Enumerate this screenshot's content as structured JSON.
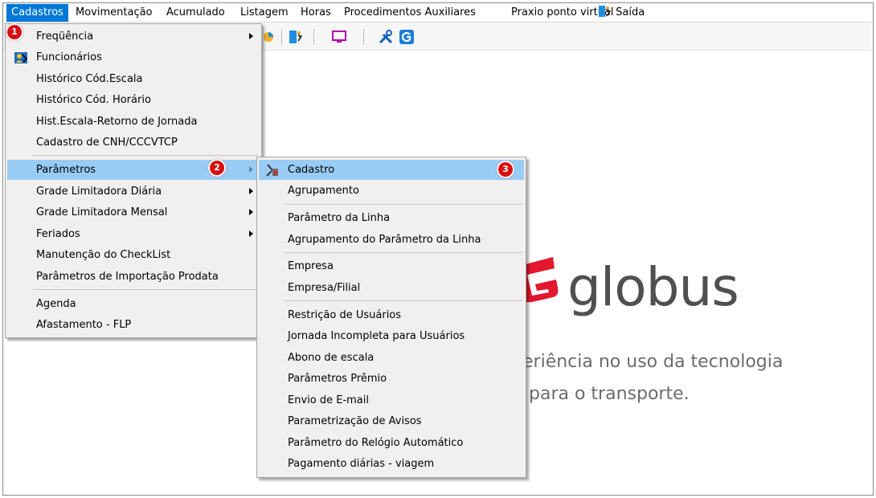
{
  "menubar": {
    "items": [
      "Cadastros",
      "Movimentação",
      "Acumulado",
      "Listagem",
      "Horas",
      "Procedimentos Auxiliares",
      "Praxio ponto virtual"
    ],
    "exit_label": "Saída"
  },
  "menu_cadastros": {
    "items": [
      "Freqüência",
      "Funcionários",
      "Histórico Cód.Escala",
      "Histórico Cód. Horário",
      "Hist.Escala-Retorno de Jornada",
      "Cadastro de CNH/CCCVTCP",
      "Parâmetros",
      "Grade Limitadora Diária",
      "Grade Limitadora Mensal",
      "Feriados",
      "Manutenção do CheckList",
      "Parâmetros de Importação Prodata",
      "Agenda",
      "Afastamento - FLP"
    ]
  },
  "menu_parametros": {
    "items": [
      "Cadastro",
      "Agrupamento",
      "Parâmetro da Linha",
      "Agrupamento do Parâmetro da Linha",
      "Empresa",
      "Empresa/Filial",
      "Restrição de Usuários",
      "Jornada Incompleta para Usuários",
      "Abono de escala",
      "Parâmetros Prêmio",
      "Envio de E-mail",
      "Parametrização de Avisos",
      "Parâmetro do Relógio Automático",
      "Pagamento diárias - viagem"
    ]
  },
  "badges": [
    "1",
    "2",
    "3"
  ],
  "brand": {
    "name": "globus",
    "tagline_1": "eriência no uso da tecnologia",
    "tagline_2": "para o transporte.",
    "accent": "#e3172d"
  },
  "colors": {
    "menu_highlight": "#99ccf5",
    "menubar_active": "#0078d7",
    "badge": "#d90f0f"
  }
}
